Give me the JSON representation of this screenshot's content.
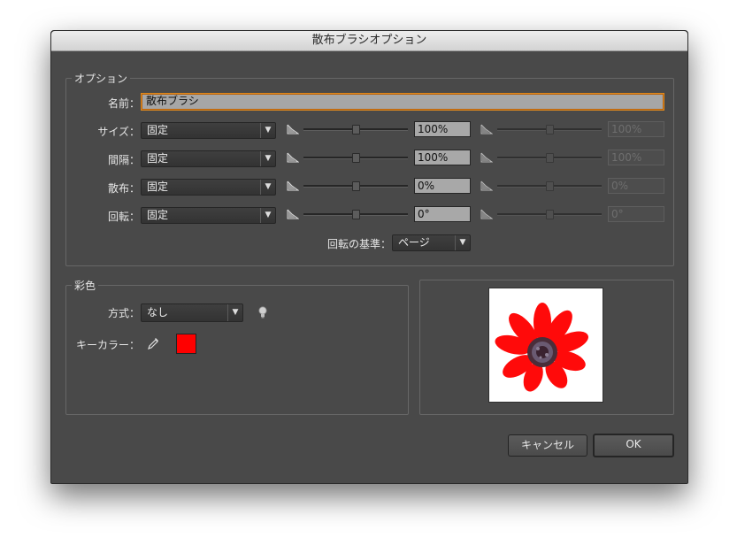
{
  "dialog": {
    "title": "散布ブラシオプション",
    "options_group": {
      "legend": "オプション",
      "name_label": "名前：",
      "name_value": "散布ブラシ",
      "rows": [
        {
          "label": "サイズ：",
          "method": "固定",
          "value": "100%",
          "value2": "100%",
          "thumb1": 0.5,
          "thumb2": 0.5
        },
        {
          "label": "間隔：",
          "method": "固定",
          "value": "100%",
          "value2": "100%",
          "thumb1": 0.5,
          "thumb2": 0.5
        },
        {
          "label": "散布：",
          "method": "固定",
          "value": "0%",
          "value2": "0%",
          "thumb1": 0.5,
          "thumb2": 0.5
        },
        {
          "label": "回転：",
          "method": "固定",
          "value": "0°",
          "value2": "0°",
          "thumb1": 0.5,
          "thumb2": 0.5
        }
      ],
      "rotation_basis_label": "回転の基準：",
      "rotation_basis_value": "ページ"
    },
    "coloring_group": {
      "legend": "彩色",
      "method_label": "方式：",
      "method_value": "なし",
      "key_color_label": "キーカラー：",
      "key_color": "#ff0000"
    },
    "buttons": {
      "cancel": "キャンセル",
      "ok": "OK"
    }
  }
}
